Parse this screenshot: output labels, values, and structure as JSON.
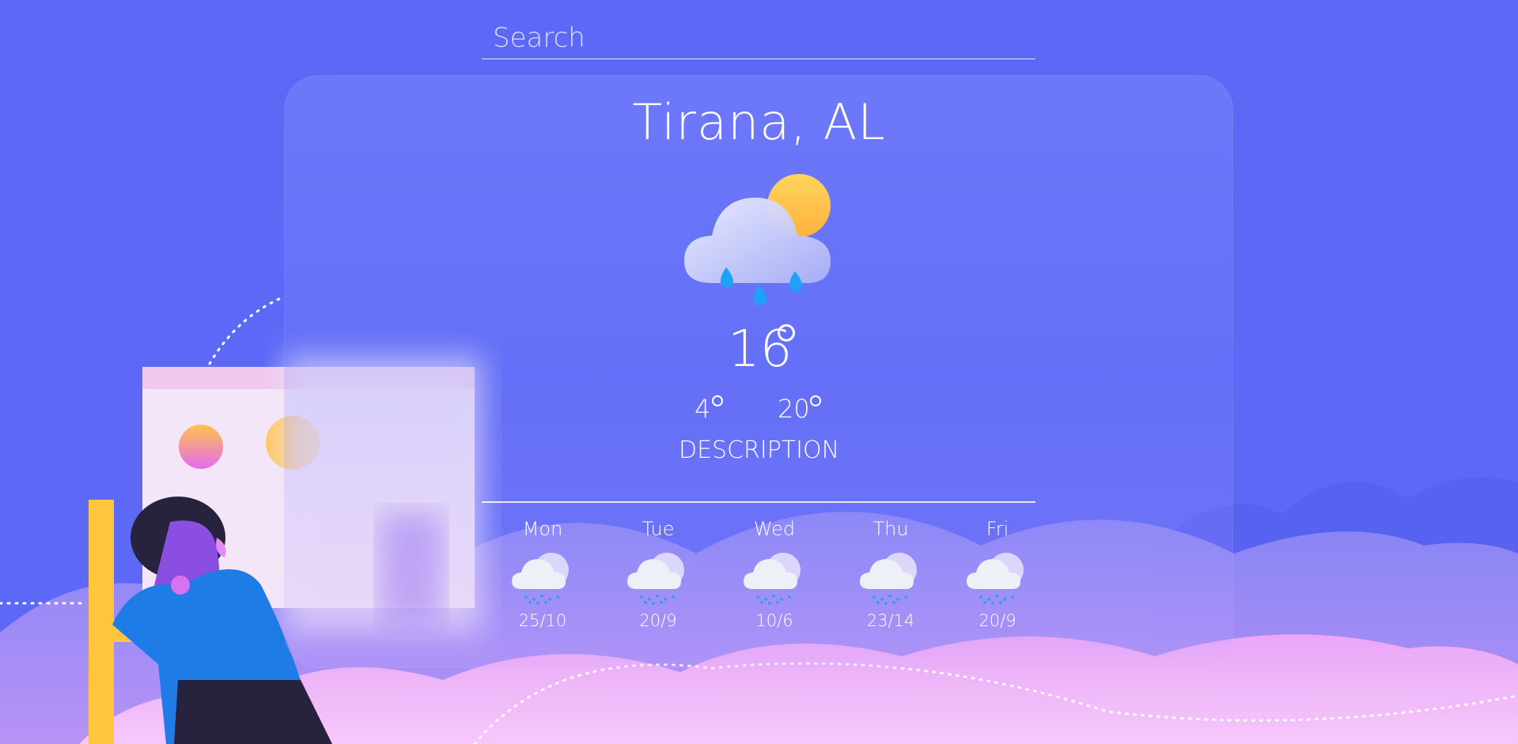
{
  "search": {
    "placeholder": "Search"
  },
  "location": {
    "city": "Tirana, AL"
  },
  "current": {
    "temp": "16",
    "temp_min": "4",
    "temp_max": "20",
    "description": "DESCRIPTION",
    "icon": "rain-cloud-sun-icon"
  },
  "forecast": [
    {
      "day": "Mon",
      "range": "25/10",
      "icon": "snow-cloud-icon"
    },
    {
      "day": "Tue",
      "range": "20/9",
      "icon": "snow-cloud-icon"
    },
    {
      "day": "Wed",
      "range": "10/6",
      "icon": "snow-cloud-icon"
    },
    {
      "day": "Thu",
      "range": "23/14",
      "icon": "snow-cloud-icon"
    },
    {
      "day": "Fri",
      "range": "20/9",
      "icon": "snow-cloud-icon"
    }
  ],
  "colors": {
    "background": "#5d69f6",
    "clouds": "#e9a6f6",
    "sun": "#ffc04a",
    "rain": "#16a2f5"
  }
}
